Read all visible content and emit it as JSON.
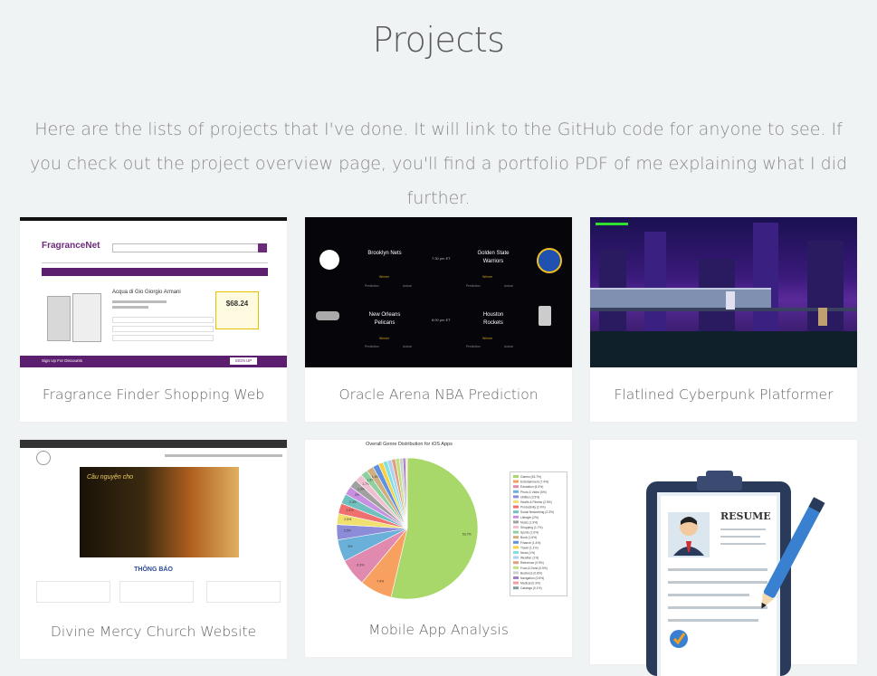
{
  "page": {
    "title": "Projects",
    "intro": "Here are the lists of projects that I've done. It will link to the GitHub code for anyone to see. If you check out the project overview page, you'll find a portfolio PDF of me explaining what I did further."
  },
  "projects": [
    {
      "label": "Fragrance Finder Shopping Web"
    },
    {
      "label": "Oracle Arena NBA Prediction"
    },
    {
      "label": "Flatlined Cyberpunk Platformer"
    },
    {
      "label": "Divine Mercy Church Website"
    },
    {
      "label": "Mobile App Analysis"
    },
    {
      "label": ""
    }
  ],
  "thumbs": {
    "fragrance": {
      "logo": "FragranceNet",
      "product": "Acqua di Gio Giorgio Armani",
      "price": "$68.24",
      "footer": "Sign Up For Discounts",
      "signup": "SIGN UP"
    },
    "nba": {
      "games": [
        {
          "home": "Brooklyn Nets",
          "away": "Golden State Warriors",
          "time": "7:30 pm ET"
        },
        {
          "home": "New Orleans Pelicans",
          "away": "Houston Rockets",
          "time": "8:00 pm ET"
        }
      ],
      "winner_label": "Winner",
      "prediction_label": "Prediction",
      "actual_label": "Actual"
    },
    "church": {
      "banner_text": "Cầu nguyện cho",
      "notice": "THÔNG BÁO"
    },
    "mobile": {
      "chart_title": "Overall Genre Distribution for iOS Apps",
      "resume": "RESUME"
    }
  },
  "chart_data": {
    "type": "pie",
    "title": "Overall Genre Distribution for iOS Apps",
    "series": [
      {
        "name": "Games",
        "value": 53.7
      },
      {
        "name": "Entertainment",
        "value": 7.4
      },
      {
        "name": "Education",
        "value": 6.3
      },
      {
        "name": "Photo & Video",
        "value": 5.0
      },
      {
        "name": "Utilities",
        "value": 3.5
      },
      {
        "name": "Health & Fitness",
        "value": 2.5
      },
      {
        "name": "Productivity",
        "value": 2.4
      },
      {
        "name": "Social Networking",
        "value": 2.3
      },
      {
        "name": "Lifestyle",
        "value": 2.0
      },
      {
        "name": "Music",
        "value": 1.9
      },
      {
        "name": "Shopping",
        "value": 1.7
      },
      {
        "name": "Sports",
        "value": 1.6
      },
      {
        "name": "Book",
        "value": 1.6
      },
      {
        "name": "Finance",
        "value": 1.4
      },
      {
        "name": "Travel",
        "value": 1.1
      },
      {
        "name": "News",
        "value": 1.0
      },
      {
        "name": "Weather",
        "value": 1.0
      },
      {
        "name": "Reference",
        "value": 0.9
      },
      {
        "name": "Food & Drink",
        "value": 0.9
      },
      {
        "name": "Business",
        "value": 0.8
      },
      {
        "name": "Navigation",
        "value": 0.6
      },
      {
        "name": "Medical",
        "value": 0.3
      },
      {
        "name": "Catalogs",
        "value": 0.1
      }
    ],
    "colors": [
      "#a8d86a",
      "#f8a060",
      "#e08ab0",
      "#6ab0d8",
      "#8c8cd8",
      "#f0e070",
      "#f07070",
      "#70c0c0",
      "#c890e0",
      "#a0a0a0",
      "#f0c0d0",
      "#90d0a0",
      "#d0b080",
      "#6090e0",
      "#f8d040",
      "#80e0e0",
      "#b0d0f0",
      "#e0a080",
      "#c0e080",
      "#d0d0d0",
      "#a080c0",
      "#f0a0a0",
      "#80a0a0"
    ]
  }
}
